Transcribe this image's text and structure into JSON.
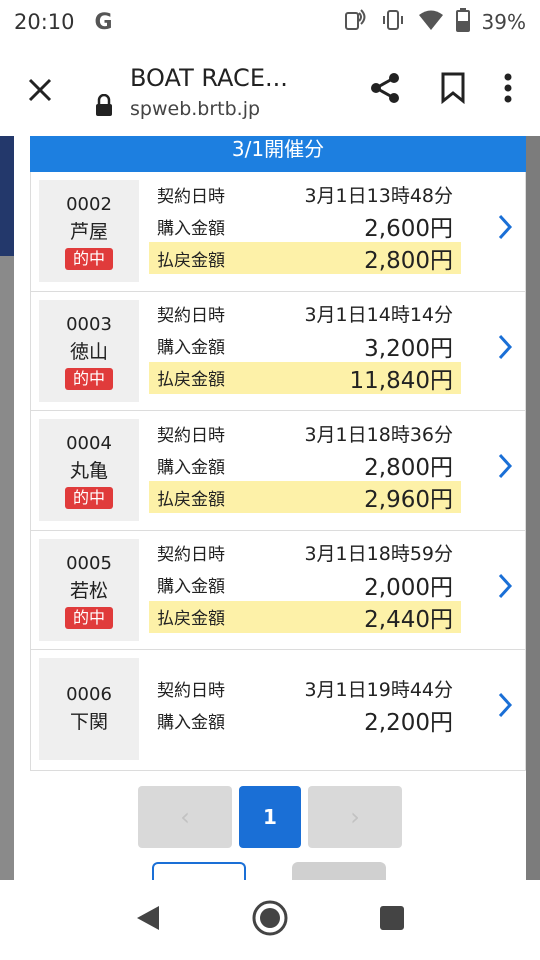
{
  "status_bar": {
    "time": "20:10",
    "google_icon": "G",
    "battery_percent": "39%"
  },
  "browser": {
    "title": "BOAT RACE...",
    "url": "spweb.brtb.jp"
  },
  "section": {
    "header": "3/1開催分"
  },
  "labels": {
    "contract_time": "契約日時",
    "purchase_amount": "購入金額",
    "payout_amount": "払戻金額",
    "hit_badge": "的中"
  },
  "bets": [
    {
      "number": "0002",
      "stadium": "芦屋",
      "hit": true,
      "time": "3月1日13時48分",
      "purchase": "2,600円",
      "payout": "2,800円"
    },
    {
      "number": "0003",
      "stadium": "徳山",
      "hit": true,
      "time": "3月1日14時14分",
      "purchase": "3,200円",
      "payout": "11,840円"
    },
    {
      "number": "0004",
      "stadium": "丸亀",
      "hit": true,
      "time": "3月1日18時36分",
      "purchase": "2,800円",
      "payout": "2,960円"
    },
    {
      "number": "0005",
      "stadium": "若松",
      "hit": true,
      "time": "3月1日18時59分",
      "purchase": "2,000円",
      "payout": "2,440円"
    },
    {
      "number": "0006",
      "stadium": "下関",
      "hit": false,
      "time": "3月1日19時44分",
      "purchase": "2,200円",
      "payout": null
    }
  ],
  "pagination": {
    "prev": "‹",
    "current": "1",
    "next": "›"
  },
  "colors": {
    "accent_blue": "#1d7fe0",
    "hit_red": "#e03b3b",
    "payout_highlight": "#fdf1a8"
  }
}
